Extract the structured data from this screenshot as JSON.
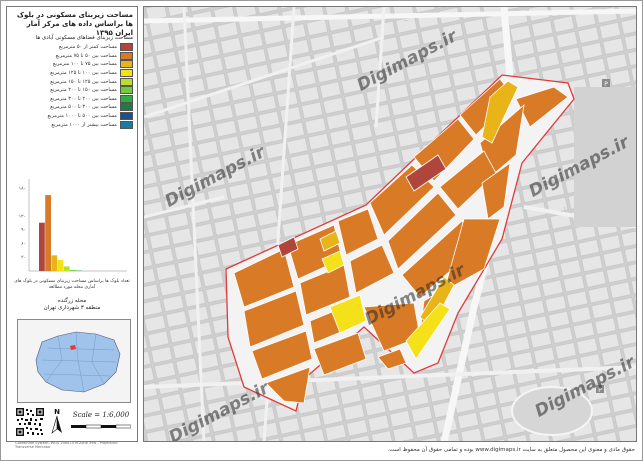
{
  "legend": {
    "title": "مساحت زیربنای فضاهای مسکونی آبادی ها",
    "items": [
      {
        "label": "مساحت کمتر از ۵۰ مترمربع",
        "color": "#b0453c"
      },
      {
        "label": "مساحت بین ۵۰ تا ۷۵ مترمربع",
        "color": "#d97a26"
      },
      {
        "label": "مساحت بین ۷۵ تا ۱۰۰ مترمربع",
        "color": "#e8b418"
      },
      {
        "label": "مساحت بین ۱۰۰ تا ۱۲۵ مترمربع",
        "color": "#f4e11a"
      },
      {
        "label": "مساحت بین ۱۲۵ تا ۱۵۰ مترمربع",
        "color": "#b8e02a"
      },
      {
        "label": "مساحت بین ۱۵۰ تا ۲۰۰ مترمربع",
        "color": "#6ccf3a"
      },
      {
        "label": "مساحت بین ۲۰۰ تا ۳۰۰ مترمربع",
        "color": "#2fae3f"
      },
      {
        "label": "مساحت بین ۳۰۰ تا ۵۰۰ مترمربع",
        "color": "#237a46"
      },
      {
        "label": "مساحت بین ۵۰۰ تا ۱۰۰۰ مترمربع",
        "color": "#1f4f8c"
      },
      {
        "label": "مساحت بیشتر از ۱۰۰۰ مترمربع",
        "color": "#1a7aa0"
      }
    ]
  },
  "map_title": "مساحت زیربنای مسکونی در بلوک ها براساس داده های مرکز آمار ایران ۱۳۹۵",
  "chart_data": {
    "type": "bar",
    "categories": [
      "<50",
      "50-75",
      "75-100",
      "100-125",
      "125-150",
      "150-200",
      "200-300",
      "300-500",
      "500-1000",
      ">1000"
    ],
    "values": [
      105,
      165,
      34,
      24,
      10,
      2,
      1,
      0,
      0,
      0
    ],
    "colors": [
      "#b0453c",
      "#d97a26",
      "#e8b418",
      "#f4e11a",
      "#b8e02a",
      "#6ccf3a",
      "#2fae3f",
      "#237a46",
      "#1f4f8c",
      "#1a7aa0"
    ],
    "yticks": [
      "۱۸۰",
      "۱۲۰",
      "۹۰",
      "۶۰",
      "۳۰"
    ],
    "ylim": [
      0,
      200
    ],
    "caption": "تعداد بلوک ها براساس مساحت زیربنای مسکونی در بلوک های آماری محله مورد مطالعه"
  },
  "locator": {
    "title": "محله زرگنده",
    "subtitle": "منطقه ۳ شهرداری تهران"
  },
  "scale_label": "Scale = 1:6,000",
  "north_letter": "N",
  "footer_note": "Coordinate System: WGS 1984 UTM Zone 39N - Projection: Transverse Mercator",
  "copyright_notice": "حقوق مادی و معنوی این محصول متعلق به سایت www.digimaps.ir بوده و تمامی حقوق آن محفوظ است.",
  "watermark_text": "Digimaps.ir",
  "colors": {
    "boundary": "#e03a3a",
    "residential": "#d97a26"
  }
}
